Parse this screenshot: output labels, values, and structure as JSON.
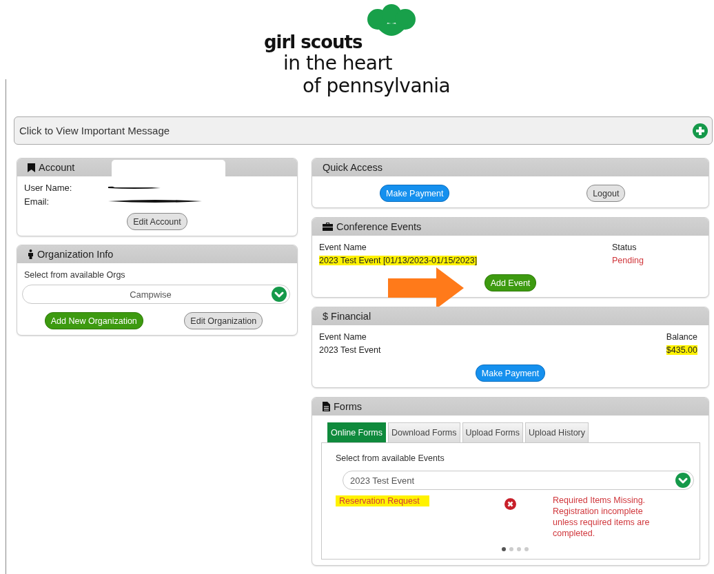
{
  "logo": {
    "line_1": "girl scouts",
    "line_2": "in the heart",
    "line_3": "of pennsylvania"
  },
  "message_bar": {
    "label": "Click to View Important Message"
  },
  "account": {
    "title": "Account",
    "fields": [
      {
        "label": "User Name:"
      },
      {
        "label": "Email:"
      }
    ],
    "button": "Edit Account"
  },
  "organization": {
    "title": "Organization Info",
    "prompt": "Select from available Orgs",
    "select_value": "Campwise",
    "buttons": [
      {
        "label": "Add New Organization",
        "kind": "primary"
      },
      {
        "label": "Edit Organization",
        "kind": "secondary"
      }
    ]
  },
  "quick_access": {
    "title": "Quick Access",
    "buttons": [
      {
        "label": "Make Payment",
        "kind": "payment"
      },
      {
        "label": "Logout",
        "kind": "secondary"
      }
    ]
  },
  "conference_events": {
    "title": "Conference Events",
    "columns": [
      "Event Name",
      "Status"
    ],
    "rows": [
      {
        "event": "2023 Test Event [01/13/2023-01/15/2023]",
        "status": "Pending",
        "highlighted": true
      }
    ],
    "button": "Add Event"
  },
  "financial": {
    "title": "$ Financial",
    "columns": [
      "Event Name",
      "Balance"
    ],
    "rows": [
      {
        "event": "2023 Test Event",
        "balance": "$435.00",
        "highlighted": true
      }
    ],
    "button": "Make Payment"
  },
  "forms": {
    "title": "Forms",
    "tabs": [
      {
        "label": "Online Forms",
        "selected": true
      },
      {
        "label": "Download Forms",
        "selected": false
      },
      {
        "label": "Upload Forms",
        "selected": false
      },
      {
        "label": "Upload History",
        "selected": false
      }
    ],
    "prompt": "Select from available Events",
    "select_value": "2023 Test Event",
    "items": [
      {
        "name": "Reservation Request",
        "highlighted": true,
        "complete": false,
        "message": "Required Items Missing. Registration incomplete unless required items are completed."
      }
    ],
    "pages": [
      {
        "selected": true
      },
      {
        "selected": false
      },
      {
        "selected": false
      },
      {
        "selected": false
      }
    ]
  }
}
